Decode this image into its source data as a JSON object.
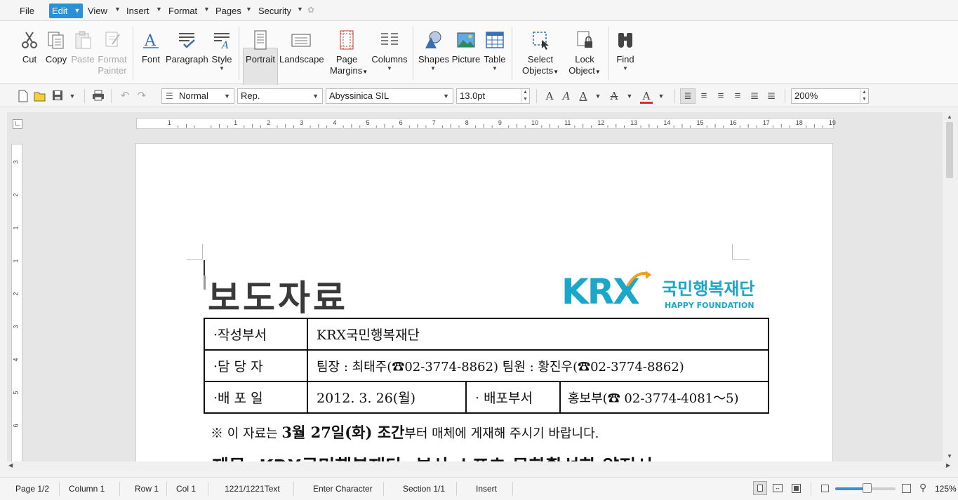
{
  "menus": [
    "File",
    "Edit",
    "View",
    "Insert",
    "Format",
    "Pages",
    "Security"
  ],
  "ribbon": {
    "cut": "Cut",
    "copy": "Copy",
    "paste": "Paste",
    "format_painter_1": "Format",
    "format_painter_2": "Painter",
    "font": "Font",
    "paragraph": "Paragraph",
    "style": "Style",
    "portrait": "Portrait",
    "landscape": "Landscape",
    "page_margins_1": "Page",
    "page_margins_2": "Margins",
    "columns": "Columns",
    "shapes": "Shapes",
    "picture": "Picture",
    "table": "Table",
    "select_objects_1": "Select",
    "select_objects_2": "Objects",
    "lock_object_1": "Lock",
    "lock_object_2": "Object",
    "find": "Find"
  },
  "format_bar": {
    "style": "Normal",
    "ref": "Rep.",
    "font": "Abyssinica SIL",
    "size": "13.0pt",
    "zoom": "200%"
  },
  "ruler_numbers": [
    "1",
    "1",
    "2",
    "3",
    "4",
    "5",
    "6",
    "7",
    "8",
    "9",
    "10",
    "11",
    "12",
    "13",
    "14",
    "15",
    "16",
    "17",
    "18",
    "19"
  ],
  "vruler_numbers": [
    "3",
    "2",
    "1",
    "1",
    "2",
    "3",
    "4",
    "5",
    "6"
  ],
  "document": {
    "title": "보도자료",
    "logo_text": "KRX",
    "logo_korean": "국민행복재단",
    "logo_english": "HAPPY FOUNDATION",
    "row1_label": "·작성부서",
    "row1_value": "KRX국민행복재단",
    "row2_label": "·담 당 자",
    "row2_value": "팀장 : 최태주(☎02-3774-8862)   팀원 : 황진우(☎02-3774-8862)",
    "row3_label": "·배 포 일",
    "row3_date": "2012. 3. 26(월)",
    "row3_dept_label": "· 배포부서",
    "row3_dept_value": "홍보부(☎ 02-3774-4081～5)",
    "note_prefix": "※ 이 자료는 ",
    "note_bold": "3월 27일(화) 조간",
    "note_suffix": "부터 매체에 게재해 주시기 바랍니다.",
    "cutoff_line": "제목: KRX국민행복재단, 부산 소프츠 문화활성화 약정서"
  },
  "status": {
    "page": "Page 1/2",
    "column": "Column 1",
    "row": "Row 1",
    "col": "Col 1",
    "text": "1221/1221Text",
    "mode": "Enter Character",
    "section": "Section 1/1",
    "insert": "Insert",
    "zoom": "125%"
  },
  "colors": {
    "accent": "#2d8fd5",
    "logo": "#1aa7c9",
    "logo_orange": "#f0a020"
  }
}
